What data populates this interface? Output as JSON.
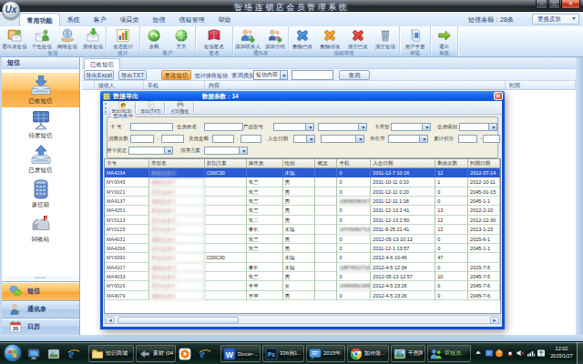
{
  "window": {
    "title": "智络连锁店会员管理系统",
    "logo": "Ux",
    "controls": [
      "minimize",
      "restore",
      "close"
    ]
  },
  "ribbon": {
    "tabs": [
      {
        "label": "常用功能",
        "active": true
      },
      {
        "label": "系统",
        "active": false
      },
      {
        "label": "客户",
        "active": false
      },
      {
        "label": "项目类",
        "active": false
      },
      {
        "label": "短信",
        "active": false
      },
      {
        "label": "信箱管理",
        "active": false
      },
      {
        "label": "帮助",
        "active": false
      }
    ],
    "sms_balance": "短信余额：28条",
    "skin_button": "更换皮肤",
    "groups": [
      {
        "label": "短信",
        "buttons": [
          {
            "label": "通讯录短信",
            "icon": "env-book"
          },
          {
            "label": "个性短信",
            "icon": "env-person"
          },
          {
            "label": "网络短信",
            "icon": "globe-hand"
          },
          {
            "label": "接收短信",
            "icon": "env-down"
          }
        ]
      },
      {
        "label": "统计",
        "buttons": [
          {
            "label": "发送统计",
            "icon": "chart"
          }
        ]
      },
      {
        "label": "客户",
        "buttons": [
          {
            "label": "余额",
            "icon": "sphere-green"
          },
          {
            "label": "主页",
            "icon": "globe-green"
          }
        ]
      },
      {
        "label": "签名",
        "buttons": [
          {
            "label": "短信签名",
            "icon": "book-red"
          }
        ]
      },
      {
        "label": "通讯录",
        "buttons": [
          {
            "label": "添加联系人",
            "icon": "people-add"
          },
          {
            "label": "添加分组",
            "icon": "person-add"
          }
        ]
      },
      {
        "label": "信箱管理",
        "buttons": [
          {
            "label": "删除已收",
            "icon": "x-blue"
          },
          {
            "label": "删除待发",
            "icon": "x-orange"
          },
          {
            "label": "清空已发",
            "icon": "x-red"
          },
          {
            "label": "清空短信",
            "icon": "trash"
          }
        ]
      },
      {
        "label": "帮助",
        "buttons": [
          {
            "label": "用户手册",
            "icon": "manual"
          }
        ]
      },
      {
        "label": "系统",
        "buttons": [
          {
            "label": "退出",
            "icon": "exit-arrow"
          }
        ]
      }
    ]
  },
  "sidebar": {
    "header": "短信",
    "items": [
      {
        "label": "已收短信",
        "icon": "tray-down",
        "selected": true
      },
      {
        "label": "待发短信",
        "icon": "panel",
        "selected": false
      },
      {
        "label": "已发短信",
        "icon": "tray-up",
        "selected": false
      },
      {
        "label": "废信箱",
        "icon": "cabinet",
        "selected": false
      },
      {
        "label": "回收站",
        "icon": "mailbox",
        "selected": false
      }
    ],
    "nav": [
      {
        "label": "短信",
        "icon": "nav-chat",
        "selected": true
      },
      {
        "label": "通讯录",
        "icon": "nav-contact",
        "selected": false
      },
      {
        "label": "日历",
        "icon": "nav-calendar",
        "selected": false
      }
    ]
  },
  "content": {
    "tab": "已收短信",
    "toolbar": {
      "export_excel": "导出Excel",
      "export_txt": "导出TXT",
      "send_sms": "发送短信",
      "stat_label": "统计接收短信",
      "query_label": "查询类别:",
      "query_type_value": "短信内容",
      "query_input_value": "",
      "query_button": "查询"
    },
    "table_headers": [
      "",
      "接收人",
      "手机",
      "内容",
      "时间"
    ]
  },
  "dialog": {
    "title": "数据导出",
    "count_label": "数据条数：14",
    "toolbar": [
      {
        "label": "导出(XLS)",
        "icon": "mini-excel"
      },
      {
        "label": "导出(TXT)",
        "icon": "mini-txt"
      },
      {
        "label": "打印预览",
        "icon": "mini-print"
      }
    ],
    "filter_title": "查询条件",
    "fields": [
      {
        "id": "card_no",
        "label": "卡  号",
        "kind": "t"
      },
      {
        "id": "mem_name",
        "label": "会员姓名",
        "kind": "t"
      },
      {
        "id": "prd_type",
        "label": "产品型号",
        "kind": "d"
      },
      {
        "id": "prd_sub",
        "label": "",
        "kind": "d"
      },
      {
        "id": "card_type",
        "label": "卡类型",
        "kind": "d"
      },
      {
        "id": "mem_lvl",
        "label": "会员级别",
        "kind": "d"
      },
      {
        "id": "consume",
        "label": "消费次数",
        "kind": "r"
      },
      {
        "id": "recharge",
        "label": "充值金额",
        "kind": "r"
      },
      {
        "id": "join_date",
        "label": "入会日期",
        "kind": "dd"
      },
      {
        "id": "city",
        "label": "所在市",
        "kind": "d"
      },
      {
        "id": "points",
        "label": "累计积分",
        "kind": "r"
      },
      {
        "id": "status",
        "label": "持卡状态",
        "kind": "d"
      },
      {
        "id": "sort",
        "label": "排序方案",
        "kind": "d"
      }
    ],
    "table": {
      "headers": [
        "卡号",
        "类型名",
        "折扣方案",
        "操作员",
        "性别",
        "概况",
        "手机",
        "入会日期",
        "剩余次数",
        "到期日期"
      ],
      "selected_row": 0,
      "rows": [
        [
          "MA4234",
          "黄金会员卡",
          "C00C30",
          "",
          "未知",
          "",
          "0",
          "2011-12-7 10:16",
          "12",
          "2012-07-14"
        ],
        [
          "MY0045",
          "储值会员卡",
          "",
          "朱三",
          "男",
          "",
          "0",
          "2011-10-11 0:10",
          "1",
          "2012-10-11"
        ],
        [
          "MY0021",
          "积分会员卡",
          "",
          "朱三",
          "男",
          "",
          "0",
          "2011-12-11 0:20",
          "0",
          "2045-01-15"
        ],
        [
          "MA4137",
          "储值会员卡",
          "",
          "朱三",
          "男",
          "",
          "13838296317",
          "2011-12-11 1:18",
          "0",
          "2045-1-1"
        ],
        [
          "MA4251",
          "黄金会员卡",
          "",
          "朱三",
          "男",
          "",
          "0",
          "2011-12-13 2:41",
          "13",
          "2012-2-10"
        ],
        [
          "MY0123",
          "积分会员卡",
          "",
          "朱二",
          "男",
          "",
          "0",
          "2011-12-13 2:50",
          "12",
          "2012-12-30"
        ],
        [
          "MY0125",
          "贵宾会员卡",
          "",
          "事长",
          "未知",
          "",
          "13709282712",
          "2011-9-25 21:41",
          "12",
          "2013-1-23"
        ],
        [
          "MA4031",
          "储值会员卡",
          "",
          "朱三",
          "男",
          "",
          "0",
          "2012-05-13 10:12",
          "0",
          "2015-6-1"
        ],
        [
          "MA4296",
          "积分会员卡",
          "",
          "朱三",
          "男",
          "",
          "0",
          "2011-12-1 13:57",
          "0",
          "2045-1-1"
        ],
        [
          "MY0090",
          "黄金会员卡",
          "C00C30",
          "",
          "未知",
          "",
          "0",
          "2012-4-6 10:49",
          "47",
          ""
        ],
        [
          "MA4107",
          "储值会员卡",
          "",
          "事长",
          "未知",
          "",
          "13874522722",
          "2012-4-5 12:34",
          "0",
          "2015-7-5"
        ],
        [
          "MA4033",
          "积分会员卡",
          "",
          "朱三",
          "男",
          "",
          "0",
          "2012-05-13 12:57",
          "10",
          "2045-7-5"
        ],
        [
          "MY0026",
          "贵宾会员卡",
          "",
          "手早",
          "女",
          "",
          "14465952305",
          "2012-4-5 23:26",
          "0",
          "2045-7-6"
        ],
        [
          "MA4079",
          "储值会员卡",
          "",
          "手早",
          "男",
          "",
          "0",
          "2012-4-5 23:26",
          "0",
          "2045-7-6"
        ]
      ]
    }
  },
  "taskbar": {
    "items": [
      {
        "icon": "tb-monitor",
        "label": "",
        "kind": "icon"
      },
      {
        "icon": "tb-viewer",
        "label": "",
        "kind": "icon"
      },
      {
        "icon": "tb-ie",
        "label": "",
        "kind": "icon"
      },
      {
        "icon": "tb-folder",
        "label": "知识商城",
        "kind": "btn"
      },
      {
        "icon": "tb-silver",
        "label": "素材 (04",
        "kind": "btn"
      },
      {
        "icon": "tb-player",
        "label": "",
        "kind": "icon"
      },
      {
        "icon": "tb-ie",
        "label": "",
        "kind": "icon"
      },
      {
        "icon": "tb-wps",
        "label": "Docer-...",
        "kind": "btn"
      },
      {
        "icon": "tb-ps",
        "label": "336例1...",
        "kind": "btn"
      },
      {
        "icon": "tb-chat",
        "label": "2015年...",
        "kind": "btn"
      },
      {
        "icon": "tb-chrome",
        "label": "如何做...",
        "kind": "btn"
      },
      {
        "icon": "tb-pic",
        "label": "千图网...",
        "kind": "btn"
      },
      {
        "icon": "tb-duo",
        "label": "双核浏...",
        "kind": "btn",
        "green": true
      }
    ],
    "tray": [
      "tray-arrow",
      "tray-blue",
      "tray-orange",
      "tray-qq",
      "tray-speaker",
      "tray-net",
      "tray-ime"
    ],
    "clock": {
      "time": "12:02",
      "date": "2015/1/27"
    },
    "colors": {
      "accent_orange": "#f9a83f",
      "dialog_blue": "#0f52cc",
      "selected_row": "#2a5ad4",
      "taskbar_teal": "#132d28"
    }
  }
}
